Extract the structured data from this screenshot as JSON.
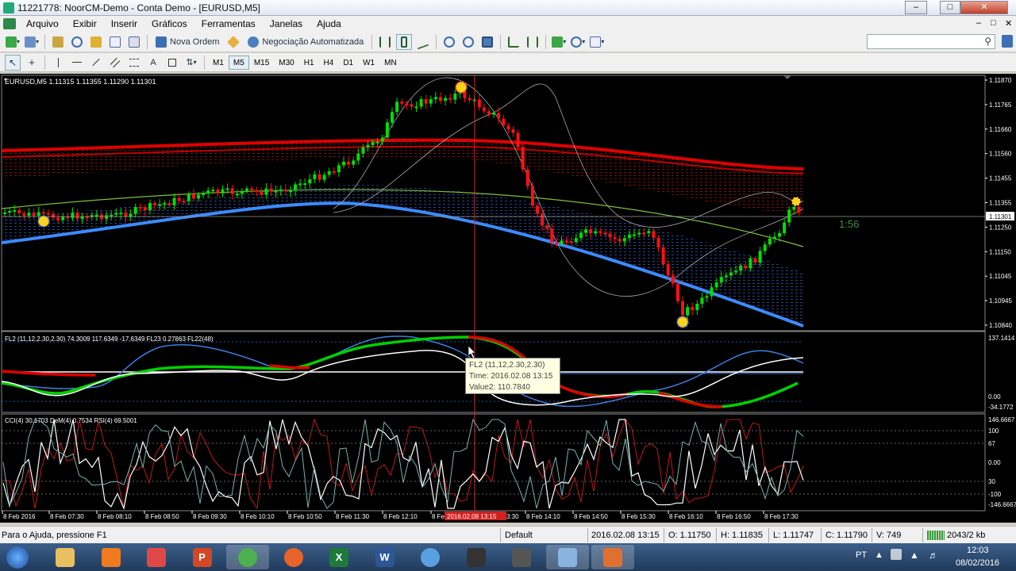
{
  "window": {
    "title": "11221778: NoorCM-Demo - Conta Demo - [EURUSD,M5]",
    "min_label": "–",
    "restore_label": "□",
    "close_label": "✕",
    "inner_min_label": "–",
    "inner_restore_label": "□",
    "inner_close_label": "✕"
  },
  "menu": [
    "Arquivo",
    "Exibir",
    "Inserir",
    "Gráficos",
    "Ferramentas",
    "Janelas",
    "Ajuda"
  ],
  "toolbar": {
    "new_order_label": "Nova Ordem",
    "autotrading_label": "Negociação Automatizada",
    "search_placeholder": "",
    "search_icon": "search-icon"
  },
  "timeframes": [
    "M1",
    "M5",
    "M15",
    "M30",
    "H1",
    "H4",
    "D1",
    "W1",
    "MN"
  ],
  "tools": {
    "text_tool_label": "A"
  },
  "chart": {
    "symbol_header": "EURUSD,M5  1.11315 1.11355 1.11290 1.11301",
    "countdown": "1:56",
    "current_price": "1.11301",
    "price_axis": [
      "1.11870",
      "1.11765",
      "1.11660",
      "1.11560",
      "1.11455",
      "1.11355",
      "1.11250",
      "1.11150",
      "1.11045",
      "1.10945",
      "1.10840"
    ],
    "osc1_header": "FL2 (11,12,2.30,2.30) 74.3009 117.6349 -17.6349  FL23 0.27863  FL22(48)",
    "osc1_axis": [
      "137.1414",
      "0.00",
      "-34.1772"
    ],
    "osc2_header": "CCI(4) 30.1703  DeM(4) 0.7534  RSI(4) 69.5001",
    "osc2_axis": [
      "146.6667",
      "100",
      "67",
      "0.00",
      "30",
      "-100",
      "-146.6667"
    ],
    "time_axis": [
      "8 Feb 2016",
      "8 Feb 07:30",
      "8 Feb 08:10",
      "8 Feb 08:50",
      "8 Feb 09:30",
      "8 Feb 10:10",
      "8 Feb 10:50",
      "8 Feb 11:30",
      "8 Feb 12:10",
      "8 Fe",
      "8 Feb 14:10",
      "8 Feb 14:50",
      "8 Feb 15:30",
      "8 Feb 16:10",
      "8 Feb 16:50",
      "8 Feb 17:30"
    ],
    "crosshair_time": "2016.02.08 13:15",
    "crosshair_time_tail": "3:30",
    "tooltip": {
      "line1": "FL2 (11,12,2.30,2.30)",
      "line2": "Time: 2016.02.08 13:15",
      "line3": "Value2: 110.7840"
    }
  },
  "status": {
    "help": "Para o Ajuda, pressione F1",
    "profile": "Default",
    "datetime": "2016.02.08 13:15",
    "open": "O: 1.11750",
    "high": "H: 1.11835",
    "low": "L: 1.11747",
    "close": "C: 1.11790",
    "volume": "V: 749",
    "traffic": "2043/2 kb"
  },
  "taskbar": {
    "language": "PT",
    "time": "12:03",
    "date": "08/02/2016",
    "apps": [
      "explorer",
      "media",
      "apps",
      "powerpoint",
      "chrome",
      "firefox",
      "excel",
      "word",
      "app-swirl",
      "device",
      "pen",
      "window-app",
      "mt4"
    ]
  },
  "colors": {
    "bull": "#00e000",
    "bear": "#ff1010",
    "ma_red": "#e00000",
    "ma_blue": "#3d8bff",
    "ma_green": "#7dc040"
  }
}
